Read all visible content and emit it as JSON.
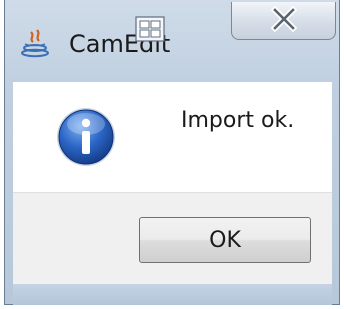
{
  "window": {
    "title": "CamEdit",
    "close_glyph": "X"
  },
  "icons": {
    "app": "java-app-icon",
    "overlay": "window-switch-icon",
    "close": "close-icon",
    "info": "info-icon"
  },
  "dialog": {
    "message": "Import ok.",
    "ok_label": "OK"
  },
  "colors": {
    "titlebar": "#c5d3e3",
    "info_blue": "#1f56b8",
    "button_border": "#707070"
  }
}
